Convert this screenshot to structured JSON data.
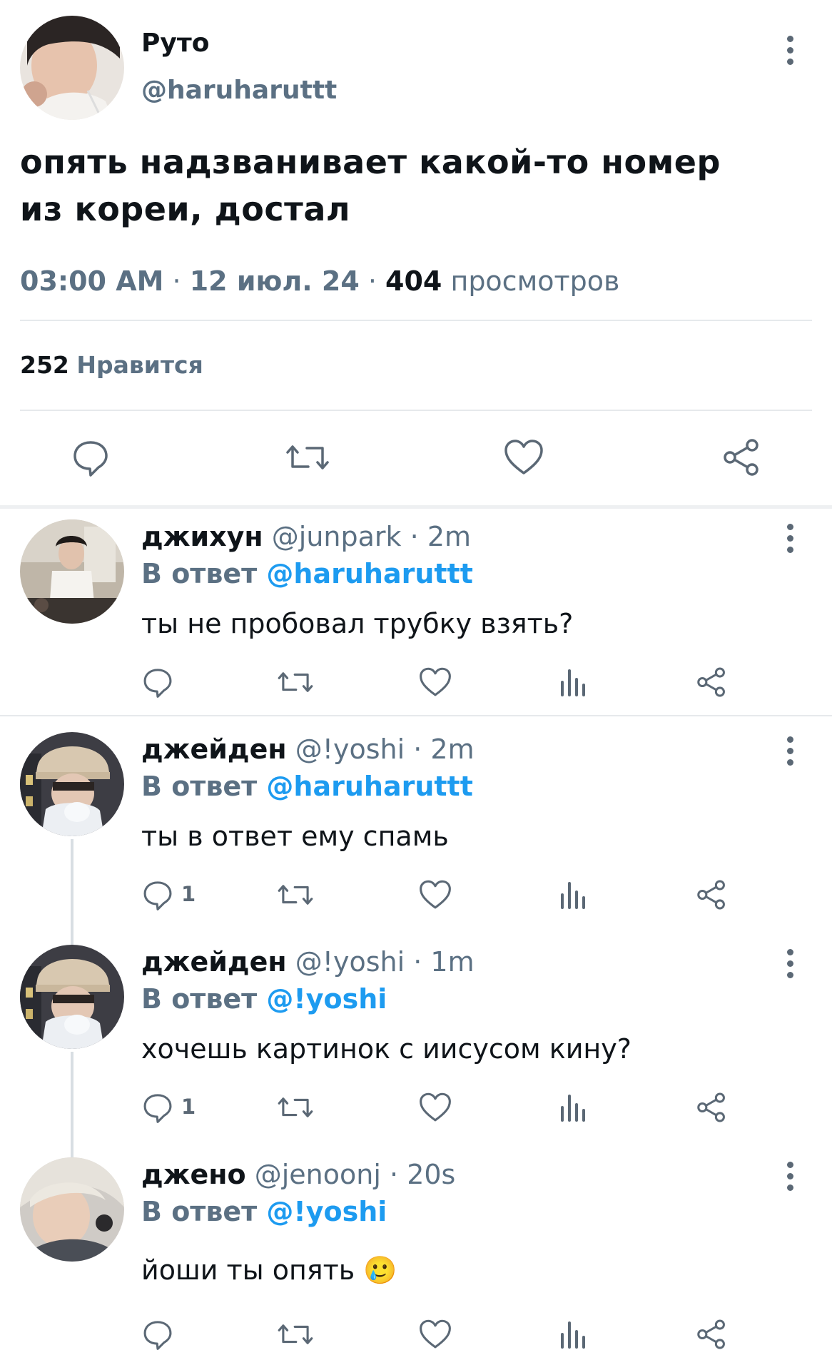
{
  "colors": {
    "accent": "#1d9bf0",
    "muted": "#5b7083",
    "text": "#0f1419",
    "divider": "#e6e9ec"
  },
  "main_tweet": {
    "display_name": "Руто",
    "handle": "@haruharuttt",
    "text_line1": "опять надзванивает какой-то номер",
    "text_line2": "из кореи, достал",
    "time": "03:00 AM",
    "sep1": "·",
    "date": "12 июл. 24",
    "sep2": "·",
    "views_count": "404",
    "views_label": "просмотров",
    "likes_count": "252",
    "likes_label": "Нравится",
    "actions": [
      "reply-icon",
      "retweet-icon",
      "like-icon",
      "share-icon"
    ]
  },
  "replies": [
    {
      "name": "джихун",
      "handle": "@junpark",
      "sep": "·",
      "time": "2m",
      "reply_to_label": "В ответ",
      "reply_to": "@haruharuttt",
      "text": "ты не пробовал трубку взять?",
      "reply_count": ""
    },
    {
      "name": "джейден",
      "handle": "@!yoshi",
      "sep": "·",
      "time": "2m",
      "reply_to_label": "В ответ",
      "reply_to": "@haruharuttt",
      "text": "ты в ответ ему спамь",
      "reply_count": "1"
    },
    {
      "name": "джейден",
      "handle": "@!yoshi",
      "sep": "·",
      "time": "1m",
      "reply_to_label": "В ответ",
      "reply_to": "@!yoshi",
      "text": "хочешь картинок с иисусом кину?",
      "reply_count": "1"
    },
    {
      "name": "джено",
      "handle": "@jenoonj",
      "sep": "·",
      "time": "20s",
      "reply_to_label": "В ответ",
      "reply_to": "@!yoshi",
      "text": "йоши ты опять",
      "emoji": "🥲",
      "reply_count": ""
    }
  ]
}
